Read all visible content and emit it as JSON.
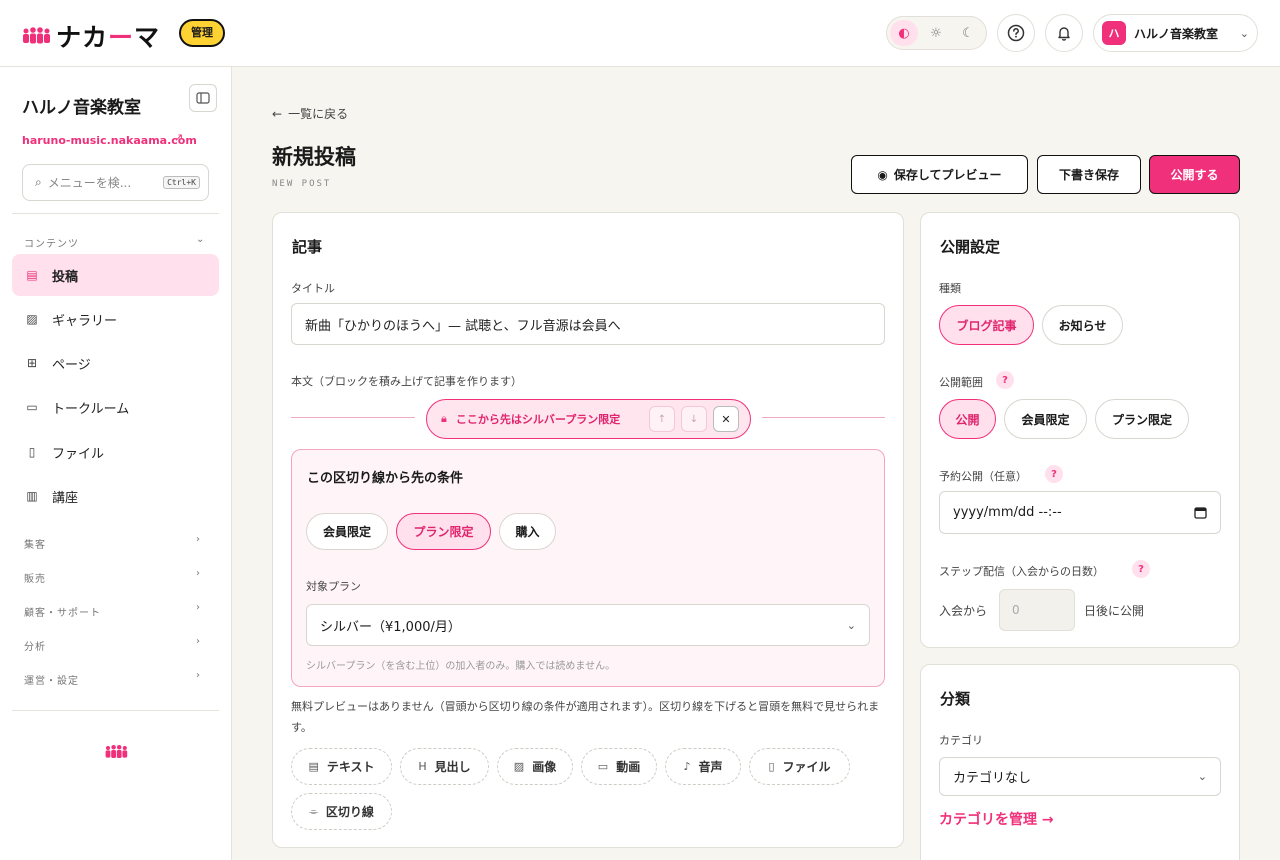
{
  "header": {
    "logo_text": "ナカ",
    "logo_dash": "ー",
    "logo_text2": "マ",
    "admin_badge": "管理",
    "theme_icons": [
      "◐",
      "☼",
      "☾"
    ],
    "account_avatar": "ハ",
    "account_name": "ハルノ音楽教室"
  },
  "sidebar": {
    "site_name": "ハルノ音楽教室",
    "site_url": "haruno-music.nakaama.com",
    "search_placeholder": "メニューを検...",
    "search_shortcut": "Ctrl+K",
    "section_contents": "コンテンツ",
    "items": [
      {
        "label": "投稿",
        "icon": "▤"
      },
      {
        "label": "ギャラリー",
        "icon": "▨"
      },
      {
        "label": "ページ",
        "icon": "⊞"
      },
      {
        "label": "トークルーム",
        "icon": "▭"
      },
      {
        "label": "ファイル",
        "icon": "▯"
      },
      {
        "label": "講座",
        "icon": "▥"
      }
    ],
    "groups": [
      "集客",
      "販売",
      "顧客・サポート",
      "分析",
      "運営・設定"
    ]
  },
  "page": {
    "back_label": "一覧に戻る",
    "title": "新規投稿",
    "subtitle": "NEW POST",
    "preview_button": "保存してプレビュー",
    "draft_button": "下書き保存",
    "publish_button": "公開する"
  },
  "article": {
    "heading": "記事",
    "title_label": "タイトル",
    "title_value": "新曲「ひかりのほうへ」— 試聴と、フル音源は会員へ",
    "body_label": "本文（ブロックを積み上げて記事を作ります）",
    "divider_text": "ここから先はシルバープラン限定",
    "condition_heading": "この区切り線から先の条件",
    "condition_options": [
      "会員限定",
      "プラン限定",
      "購入"
    ],
    "condition_selected": "プラン限定",
    "plan_label": "対象プラン",
    "plan_value": "シルバー（¥1,000/月）",
    "plan_hint": "シルバープラン（を含む上位）の加入者のみ。購入では読めません。",
    "preview_note": "無料プレビューはありません（冒頭から区切り線の条件が適用されます）。区切り線を下げると冒頭を無料で見せられます。",
    "blocks": [
      {
        "label": "テキスト",
        "icon": "▤"
      },
      {
        "label": "見出し",
        "icon": "H"
      },
      {
        "label": "画像",
        "icon": "▨"
      },
      {
        "label": "動画",
        "icon": "▭"
      },
      {
        "label": "音声",
        "icon": "♪"
      },
      {
        "label": "ファイル",
        "icon": "▯"
      },
      {
        "label": "区切り線",
        "icon": "⌯"
      }
    ]
  },
  "publish": {
    "heading": "公開設定",
    "type_label": "種類",
    "type_options": [
      "ブログ記事",
      "お知らせ"
    ],
    "type_selected": "ブログ記事",
    "scope_label": "公開範囲",
    "scope_options": [
      "公開",
      "会員限定",
      "プラン限定"
    ],
    "scope_selected": "公開",
    "schedule_label": "予約公開（任意）",
    "schedule_value": "yyyy/mm/dd --:--",
    "step_label": "ステップ配信（入会からの日数）",
    "step_prefix": "入会から",
    "step_value": "0",
    "step_suffix": "日後に公開"
  },
  "category": {
    "heading": "分類",
    "label": "カテゴリ",
    "value": "カテゴリなし",
    "manage_link": "カテゴリを管理 →"
  },
  "colors": {
    "accent": "#f0307a",
    "accent_light": "#ffe0ec",
    "badge": "#ffd234"
  }
}
